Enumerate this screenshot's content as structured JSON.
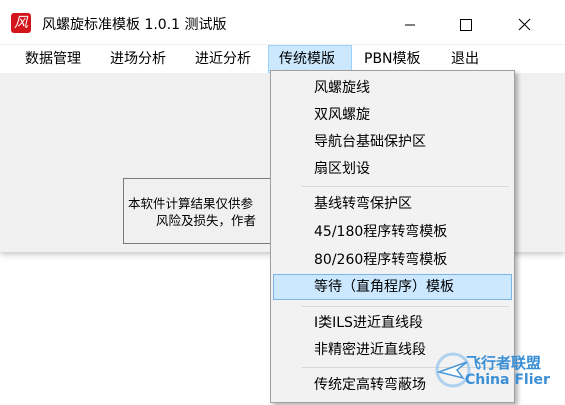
{
  "window": {
    "title": "风螺旋标准模板 1.0.1 测试版",
    "icon_glyph": "㐀",
    "icon_color": "#d4141b"
  },
  "menubar": {
    "items": [
      {
        "label": "数据管理"
      },
      {
        "label": "进场分析"
      },
      {
        "label": "进近分析"
      },
      {
        "label": "传统模版"
      },
      {
        "label": "PBN模板"
      },
      {
        "label": "退出"
      }
    ]
  },
  "message": {
    "line1": "本软件计算结果仅供参",
    "line2": "风险及损失，作者"
  },
  "dropdown": {
    "items": [
      {
        "label": "风螺旋线"
      },
      {
        "label": "双风螺旋"
      },
      {
        "label": "导航台基础保护区"
      },
      {
        "label": "扇区划设"
      },
      {
        "label": "基线转弯保护区"
      },
      {
        "label": "45/180程序转弯模板"
      },
      {
        "label": "80/260程序转弯模板"
      },
      {
        "label": "等待（直角程序）模板"
      },
      {
        "label": "I类ILS进近直线段"
      },
      {
        "label": "非精密进近直线段"
      },
      {
        "label": "传统定高转弯蔽场"
      }
    ]
  },
  "watermark": {
    "line1": "飞行者联盟",
    "line2": "China Flier"
  },
  "colors": {
    "highlight": "#cce8ff",
    "highlight_border": "#99d1ff"
  }
}
